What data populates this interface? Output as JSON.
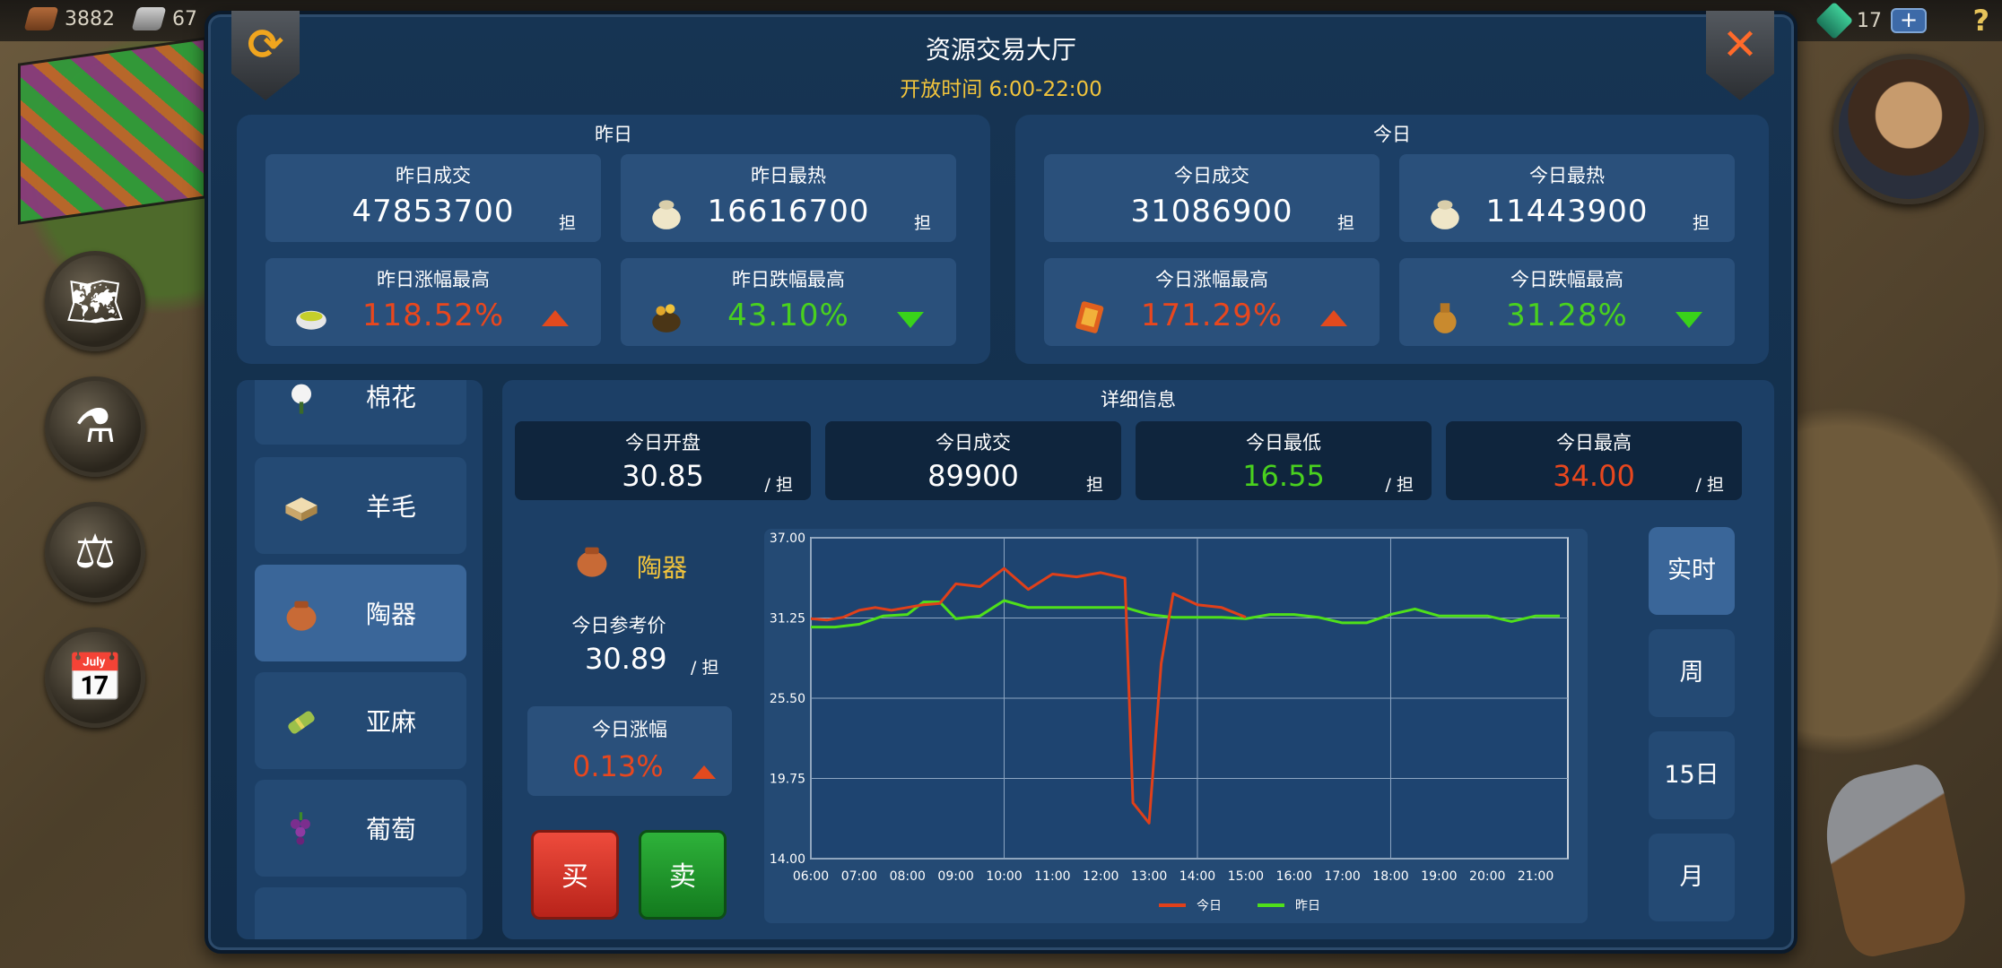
{
  "topbar": {
    "wood": "3882",
    "iron": "67",
    "gems": "17",
    "plus": "+",
    "help": "?"
  },
  "window": {
    "title": "资源交易大厅",
    "hours": "开放时间 6:00-22:00"
  },
  "yesterday": {
    "heading": "昨日",
    "volume_label": "昨日成交",
    "volume": "47853700",
    "hottest_label": "昨日最热",
    "hottest": "16616700",
    "top_gain_label": "昨日涨幅最高",
    "top_gain": "118.52%",
    "top_drop_label": "昨日跌幅最高",
    "top_drop": "43.10%",
    "unit": "担"
  },
  "today": {
    "heading": "今日",
    "volume_label": "今日成交",
    "volume": "31086900",
    "hottest_label": "今日最热",
    "hottest": "11443900",
    "top_gain_label": "今日涨幅最高",
    "top_gain": "171.29%",
    "top_drop_label": "今日跌幅最高",
    "top_drop": "31.28%",
    "unit": "担"
  },
  "goods": [
    {
      "name": "棉花",
      "icon": "cotton-icon"
    },
    {
      "name": "羊毛",
      "icon": "wool-icon"
    },
    {
      "name": "陶器",
      "icon": "pottery-icon",
      "active": true
    },
    {
      "name": "亚麻",
      "icon": "flax-icon"
    },
    {
      "name": "葡萄",
      "icon": "grape-icon"
    }
  ],
  "detail": {
    "heading": "详细信息",
    "open_label": "今日开盘",
    "open": "30.85",
    "volume_label": "今日成交",
    "volume": "89900",
    "low_label": "今日最低",
    "low": "16.55",
    "high_label": "今日最高",
    "high": "34.00",
    "per_unit": "/ 担",
    "unit": "担",
    "item_name": "陶器",
    "ref_label": "今日参考价",
    "ref_price": "30.89",
    "change_label": "今日涨幅",
    "change": "0.13%",
    "buy": "买",
    "sell": "卖"
  },
  "ranges": [
    {
      "label": "实时",
      "active": true
    },
    {
      "label": "周"
    },
    {
      "label": "15日"
    },
    {
      "label": "月"
    }
  ],
  "colors": {
    "today_line": "#e0401a",
    "yesterday_line": "#4fe01a",
    "up": "#e8471e",
    "down": "#49d11e",
    "accent": "#f2c43c"
  },
  "chart_data": {
    "type": "line",
    "ylim": [
      14.0,
      37.0
    ],
    "y_ticks": [
      "37.00",
      "31.25",
      "25.50",
      "19.75",
      "14.00"
    ],
    "x_ticks": [
      "06:00",
      "07:00",
      "08:00",
      "09:00",
      "10:00",
      "11:00",
      "12:00",
      "13:00",
      "14:00",
      "15:00",
      "16:00",
      "17:00",
      "18:00",
      "19:00",
      "20:00",
      "21:00"
    ],
    "grid": true,
    "legend": "bottom",
    "series": [
      {
        "name": "今日",
        "points": [
          [
            "06:00",
            31.2
          ],
          [
            "06:20",
            31.1
          ],
          [
            "06:40",
            31.3
          ],
          [
            "07:00",
            31.8
          ],
          [
            "07:20",
            32.0
          ],
          [
            "07:40",
            31.8
          ],
          [
            "08:00",
            32.0
          ],
          [
            "08:20",
            32.2
          ],
          [
            "08:40",
            32.3
          ],
          [
            "09:00",
            33.7
          ],
          [
            "09:30",
            33.5
          ],
          [
            "10:00",
            34.8
          ],
          [
            "10:30",
            33.3
          ],
          [
            "11:00",
            34.4
          ],
          [
            "11:30",
            34.2
          ],
          [
            "12:00",
            34.5
          ],
          [
            "12:30",
            34.1
          ],
          [
            "12:40",
            18.0
          ],
          [
            "13:00",
            16.55
          ],
          [
            "13:15",
            28.0
          ],
          [
            "13:30",
            33.0
          ],
          [
            "13:45",
            32.6
          ],
          [
            "14:00",
            32.2
          ],
          [
            "14:30",
            32.0
          ],
          [
            "15:00",
            31.3
          ]
        ]
      },
      {
        "name": "昨日",
        "points": [
          [
            "06:00",
            30.6
          ],
          [
            "06:30",
            30.6
          ],
          [
            "07:00",
            30.8
          ],
          [
            "07:30",
            31.4
          ],
          [
            "08:00",
            31.5
          ],
          [
            "08:20",
            32.4
          ],
          [
            "08:40",
            32.4
          ],
          [
            "09:00",
            31.2
          ],
          [
            "09:30",
            31.4
          ],
          [
            "10:00",
            32.5
          ],
          [
            "10:30",
            32.0
          ],
          [
            "11:00",
            32.0
          ],
          [
            "11:30",
            32.0
          ],
          [
            "12:00",
            32.0
          ],
          [
            "12:30",
            32.0
          ],
          [
            "13:00",
            31.5
          ],
          [
            "13:30",
            31.3
          ],
          [
            "14:00",
            31.3
          ],
          [
            "14:30",
            31.3
          ],
          [
            "15:00",
            31.2
          ],
          [
            "15:30",
            31.5
          ],
          [
            "16:00",
            31.5
          ],
          [
            "16:30",
            31.3
          ],
          [
            "17:00",
            30.9
          ],
          [
            "17:30",
            30.9
          ],
          [
            "18:00",
            31.5
          ],
          [
            "18:30",
            31.9
          ],
          [
            "19:00",
            31.4
          ],
          [
            "19:30",
            31.4
          ],
          [
            "20:00",
            31.4
          ],
          [
            "20:30",
            31.0
          ],
          [
            "21:00",
            31.4
          ],
          [
            "21:30",
            31.4
          ]
        ]
      }
    ]
  }
}
